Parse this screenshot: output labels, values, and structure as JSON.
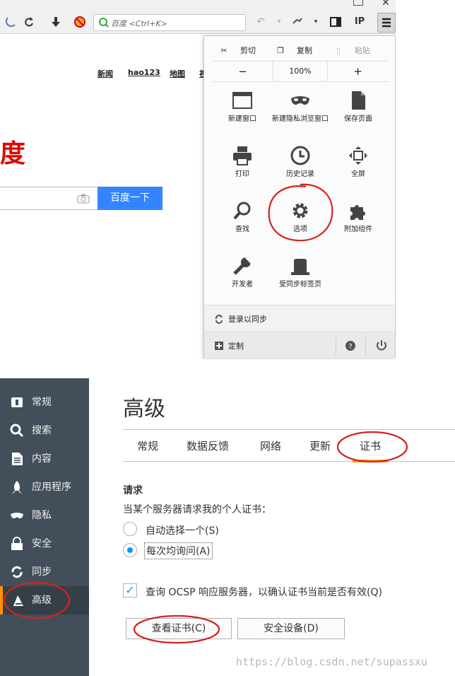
{
  "browser": {
    "search_placeholder": "百度 <Ctrl+K>",
    "top_links": [
      "新闻",
      "hao123",
      "地图",
      "视"
    ],
    "logo_text": "度",
    "search_button": "百度一下"
  },
  "menu": {
    "edit_row": {
      "cut": "剪切",
      "copy": "复制",
      "paste": "粘贴"
    },
    "zoom_row": {
      "minus": "−",
      "level": "100%",
      "plus": "+"
    },
    "items": [
      {
        "label": "新建窗口",
        "icon": "new-window-icon"
      },
      {
        "label": "新建隐私浏览窗口",
        "icon": "private-mask-icon"
      },
      {
        "label": "保存页面",
        "icon": "save-page-icon"
      },
      {
        "label": "打印",
        "icon": "print-icon"
      },
      {
        "label": "历史记录",
        "icon": "history-clock-icon"
      },
      {
        "label": "全屏",
        "icon": "fullscreen-icon"
      },
      {
        "label": "查找",
        "icon": "find-magnifier-icon"
      },
      {
        "label": "选项",
        "icon": "options-gear-icon"
      },
      {
        "label": "附加组件",
        "icon": "addons-puzzle-icon"
      },
      {
        "label": "开发者",
        "icon": "developer-wrench-icon"
      },
      {
        "label": "受同步标签页",
        "icon": "synced-tabs-icon"
      }
    ],
    "sync_label": "登录以同步",
    "customize_label": "定制"
  },
  "prefs": {
    "sidebar": [
      {
        "label": "常规",
        "icon": "general-icon"
      },
      {
        "label": "搜索",
        "icon": "search-icon"
      },
      {
        "label": "内容",
        "icon": "content-icon"
      },
      {
        "label": "应用程序",
        "icon": "applications-icon"
      },
      {
        "label": "隐私",
        "icon": "privacy-mask-icon"
      },
      {
        "label": "安全",
        "icon": "security-lock-icon"
      },
      {
        "label": "同步",
        "icon": "sync-icon"
      },
      {
        "label": "高级",
        "icon": "advanced-icon"
      }
    ],
    "active_sidebar": "高级",
    "title": "高级",
    "tabs": [
      "常规",
      "数据反馈",
      "网络",
      "更新",
      "证书"
    ],
    "active_tab": "证书",
    "requests_heading": "请求",
    "requests_desc": "当某个服务器请求我的个人证书：",
    "radio_auto": "自动选择一个(S)",
    "radio_ask": "每次均询问(A)",
    "radio_selected": "每次均询问(A)",
    "ocsp_label": "查询 OCSP 响应服务器，以确认证书当前是否有效(Q)",
    "ocsp_checked": true,
    "view_cert_button": "查看证书(C)",
    "security_devices_button": "安全设备(D)"
  },
  "watermark": "https://blog.csdn.net/supassxu",
  "colors": {
    "accent": "#ff9500",
    "sidebar_bg": "#424f5a",
    "baidu_blue": "#3385ff",
    "baidu_red": "#e10602",
    "annotation_red": "#d42222"
  }
}
